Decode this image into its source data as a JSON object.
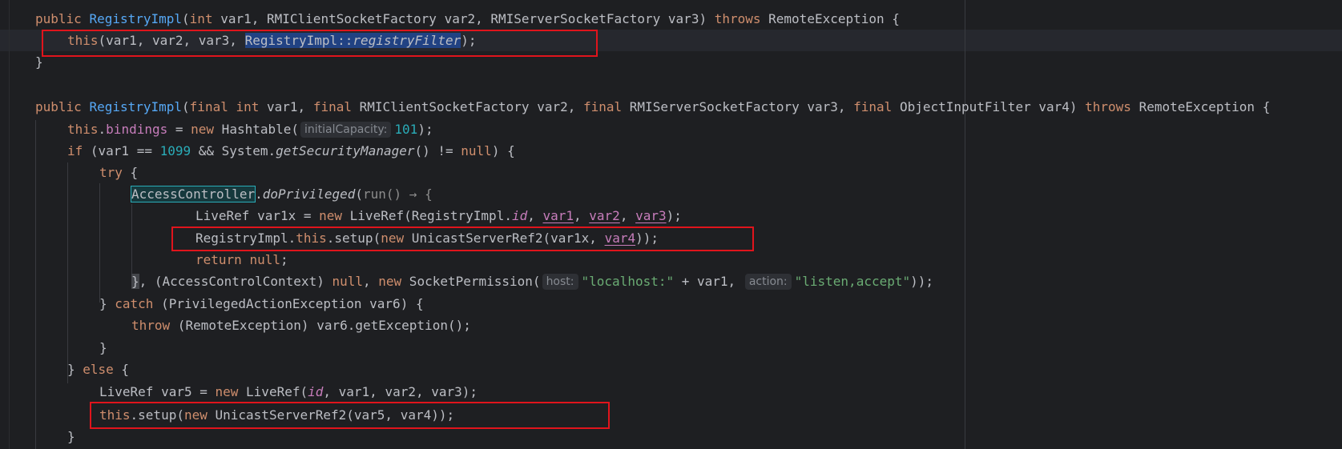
{
  "lines": {
    "l1": {
      "kw_public": "public",
      "name": "RegistryImpl",
      "open": "(",
      "kw_int": "int",
      "params": " var1, RMIClientSocketFactory var2, RMIServerSocketFactory var3) ",
      "kw_throws": "throws",
      "exc": " RemoteException {"
    },
    "l2": {
      "kw_this": "this",
      "args": "(var1, var2, var3, ",
      "sel_class": "RegistryImpl::",
      "sel_method": "registryFilter",
      "end": ");"
    },
    "l3": {
      "text": "}"
    },
    "l4": {
      "kw_public": "public",
      "name": "RegistryImpl",
      "open": "(",
      "kw_final1": "final",
      "kw_int": "int",
      "p1": " var1, ",
      "kw_final2": "final",
      "p2": " RMIClientSocketFactory var2, ",
      "kw_final3": "final",
      "p3": " RMIServerSocketFactory var3, ",
      "kw_final4": "final",
      "p4": " ObjectInputFilter var4) ",
      "kw_throws": "throws",
      "exc": " RemoteException {"
    },
    "l5": {
      "kw_this": "this",
      "dot": ".",
      "field": "bindings",
      "eq": " = ",
      "kw_new": "new",
      "cls": " Hashtable(",
      "hint": "initialCapacity:",
      "num": "101",
      "end": ");"
    },
    "l6": {
      "kw_if": "if",
      "a": " (var1 == ",
      "num": "1099",
      "b": " && System.",
      "method": "getSecurityManager",
      "c": "() != ",
      "kw_null": "null",
      "d": ") {"
    },
    "l7": {
      "kw_try": "try",
      "rest": " {"
    },
    "l8": {
      "boxed": "AccessController",
      "dot": ".",
      "method": "doPrivileged",
      "open": "(",
      "lambda": "run() → {"
    },
    "l9": {
      "a": "LiveRef var1x = ",
      "kw_new": "new",
      "b": " LiveRef(RegistryImpl.",
      "id": "id",
      "c": ", ",
      "v1": "var1",
      "d": ", ",
      "v2": "var2",
      "e": ", ",
      "v3": "var3",
      "f": ");"
    },
    "l10": {
      "a": "RegistryImpl.",
      "kw_this": "this",
      "b": ".setup(",
      "kw_new": "new",
      "c": " UnicastServerRef2(var1x, ",
      "v4": "var4",
      "d": "));"
    },
    "l11": {
      "kw_return": "return",
      "sp": " ",
      "kw_null": "null",
      "end": ";"
    },
    "l12": {
      "brace": "}",
      "a": ", (AccessControlContext) ",
      "kw_null": "null",
      "b": ", ",
      "kw_new": "new",
      "c": " SocketPermission(",
      "hint_host": "host:",
      "str1": "\"localhost:\"",
      "d": " + var1, ",
      "hint_action": "action:",
      "str2": "\"listen,accept\"",
      "e": "));"
    },
    "l13": {
      "a": "} ",
      "kw_catch": "catch",
      "b": " (PrivilegedActionException var6) {"
    },
    "l14": {
      "kw_throw": "throw",
      "b": " (RemoteException) var6.getException();"
    },
    "l15": {
      "text": "}"
    },
    "l16": {
      "a": "} ",
      "kw_else": "else",
      "b": " {"
    },
    "l17": {
      "a": "LiveRef var5 = ",
      "kw_new": "new",
      "b": " LiveRef(",
      "id": "id",
      "c": ", var1, var2, var3);"
    },
    "l18": {
      "kw_this": "this",
      "a": ".setup(",
      "kw_new": "new",
      "b": " UnicastServerRef2(var5, var4));"
    },
    "l19": {
      "text": "}"
    }
  },
  "colors": {
    "background": "#1e1f22",
    "keyword": "#cf8e6d",
    "method": "#56a8f5",
    "field": "#c77dbb",
    "number": "#2aacb8",
    "string": "#6aab73",
    "selection": "#214283",
    "annotation_box": "#e0141c"
  }
}
